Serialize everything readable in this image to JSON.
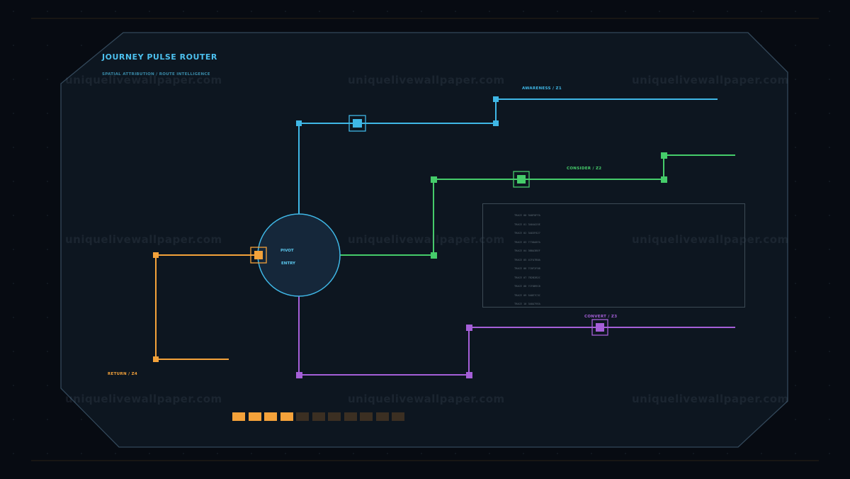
{
  "header": {
    "title": "JOURNEY PULSE ROUTER",
    "subtitle": "SPATIAL ATTRIBUTION / ROUTE INTELLIGENCE"
  },
  "hub": {
    "label_top": "PIVOT",
    "label_bottom": "ENTRY"
  },
  "routes": {
    "awareness": {
      "label": "AWARENESS / Z1",
      "color": "#3fb7e6"
    },
    "consider": {
      "label": "CONSIDER / Z2",
      "color": "#45cc6a"
    },
    "convert": {
      "label": "CONVERT / Z3",
      "color": "#a55fd8"
    },
    "return": {
      "label": "RETURN / Z4",
      "color": "#f4a23a"
    }
  },
  "log": {
    "lines": [
      "TRACE 00 9A8F0FFA",
      "TRACE 01 3A84A25E",
      "TRACE 02 3A83F827",
      "TRACE 03 7738A8FA",
      "TRACE 04 3B8A3BEF",
      "TRACE 05 4CFA7B0A",
      "TRACE 06 7C0F2F08",
      "TRACE 07 7B2B2B2C",
      "TRACE 08 7CF0B9C8",
      "TRACE 09 5A8E7C3C",
      "TRACE 10 3A8A79EA"
    ]
  },
  "progress": {
    "filled": 4,
    "total": 11,
    "fill_color": "#f4a23a",
    "empty_color": "#3b2f22"
  },
  "watermark": {
    "text": "uniquelivewallpaper.com"
  }
}
